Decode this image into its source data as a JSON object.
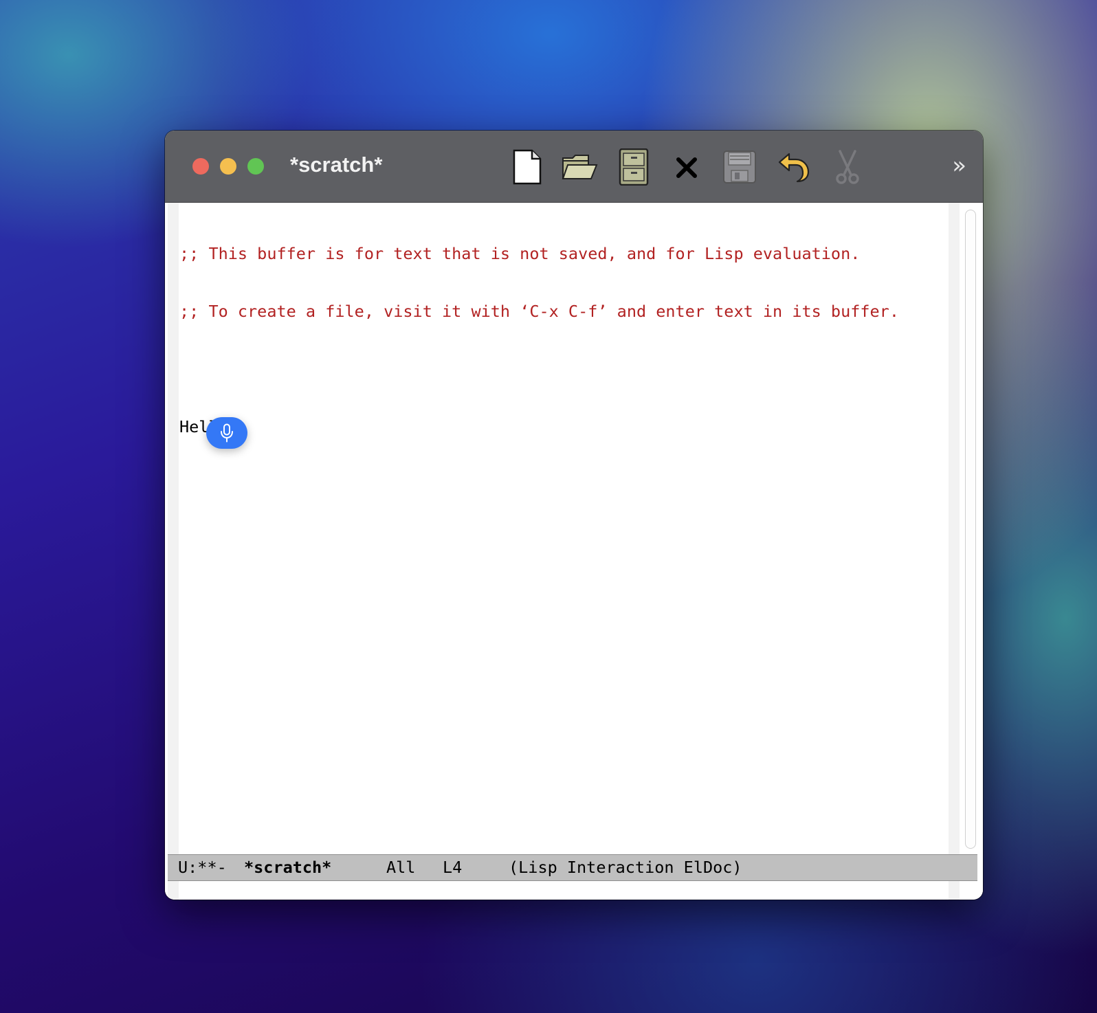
{
  "window": {
    "title": "*scratch*"
  },
  "toolbar": {
    "buttons": [
      {
        "icon": "new-file-icon"
      },
      {
        "icon": "open-folder-icon"
      },
      {
        "icon": "file-cabinet-icon"
      },
      {
        "icon": "close-buffer-icon"
      },
      {
        "icon": "save-floppy-icon"
      },
      {
        "icon": "undo-arrow-icon"
      },
      {
        "icon": "cut-scissors-icon"
      }
    ],
    "overflow": "»"
  },
  "buffer": {
    "lines": [
      ";; This buffer is for text that is not saved, and for Lisp evaluation.",
      ";; To create a file, visit it with ‘C-x C-f’ and enter text in its buffer.",
      "",
      "Hello"
    ]
  },
  "modeline": {
    "status": "U:**-",
    "buffer_name": "*scratch*",
    "position": "All",
    "line": "L4",
    "modes": "(Lisp Interaction ElDoc)"
  },
  "colors": {
    "comment": "#b22222",
    "titlebar": "#5e5f63",
    "modeline": "#bfbfbf",
    "dictation": "#3478f6"
  }
}
